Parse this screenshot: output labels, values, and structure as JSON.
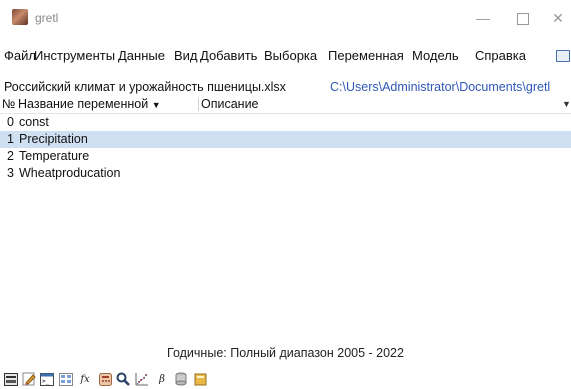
{
  "window": {
    "title": "gretl"
  },
  "menu": [
    {
      "label": "Файл"
    },
    {
      "label": "Инструменты"
    },
    {
      "label": "Данные"
    },
    {
      "label": "Вид"
    },
    {
      "label": "Добавить"
    },
    {
      "label": "Выборка"
    },
    {
      "label": "Переменная"
    },
    {
      "label": "Модель"
    },
    {
      "label": "Справка"
    }
  ],
  "file": {
    "name": "Российский климат и урожайность пшеницы.xlsx",
    "path": "C:\\Users\\Administrator\\Documents\\gretl"
  },
  "table": {
    "headers": {
      "number": "№",
      "variable": "Название переменной",
      "description": "Описание"
    },
    "rows": [
      {
        "id": "0",
        "name": "const",
        "description": ""
      },
      {
        "id": "1",
        "name": "Precipitation",
        "description": ""
      },
      {
        "id": "2",
        "name": "Temperature",
        "description": ""
      },
      {
        "id": "3",
        "name": "Wheatproducation",
        "description": ""
      }
    ],
    "selected_row_index": 1
  },
  "status": {
    "text": "Годичные: Полный диапазон 2005 - 2022"
  },
  "toolbar": {
    "icons": [
      "terminal-icon",
      "script-editor-icon",
      "console-icon",
      "session-icon-view-icon",
      "function-icon",
      "calculator-icon",
      "search-icon",
      "scatterplot-icon",
      "beta-icon",
      "database-icon",
      "book-icon"
    ],
    "fx_label": "fx",
    "beta_label": "β"
  },
  "colors": {
    "selection": "#cfe0f2",
    "path_link": "#2f58b8"
  }
}
